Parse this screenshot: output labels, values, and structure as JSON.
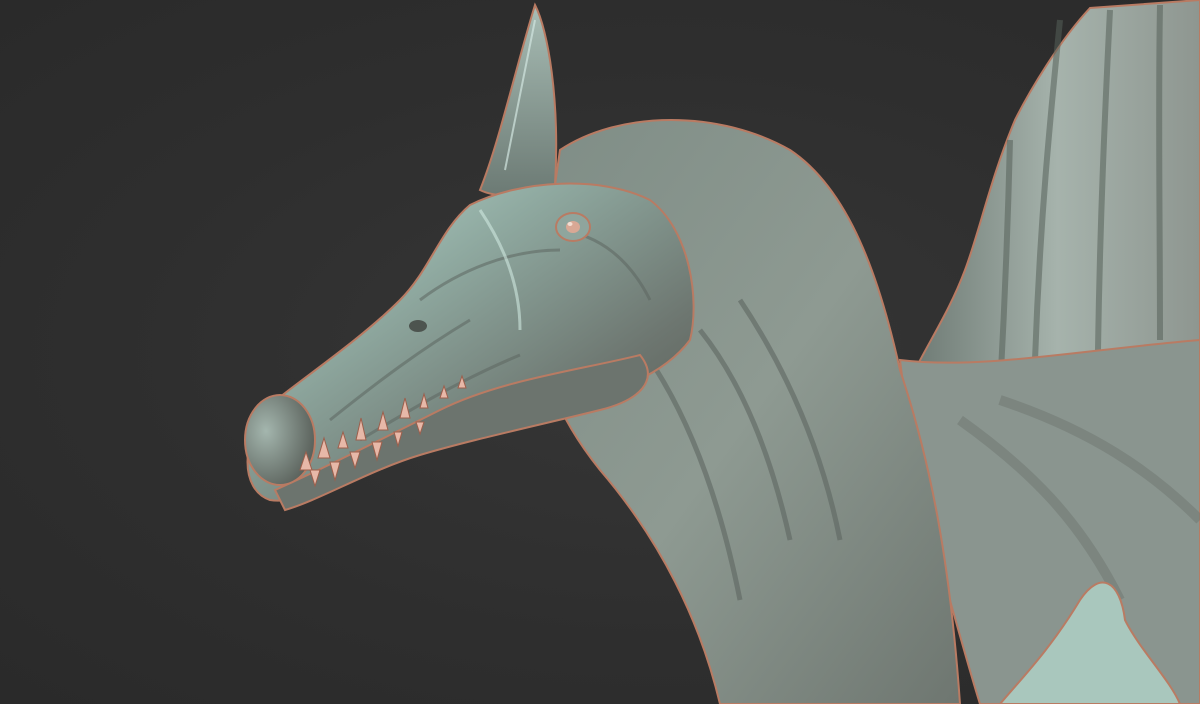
{
  "scene": {
    "subject": "sculpted-dinosaur-head",
    "colors": {
      "background": "#2f2f2f",
      "skin_dark": "#5a5a54",
      "skin_mid": "#8a9690",
      "skin_light": "#bfe0d6",
      "rim": "#b97b63",
      "teeth": "#e7b8a8"
    }
  }
}
